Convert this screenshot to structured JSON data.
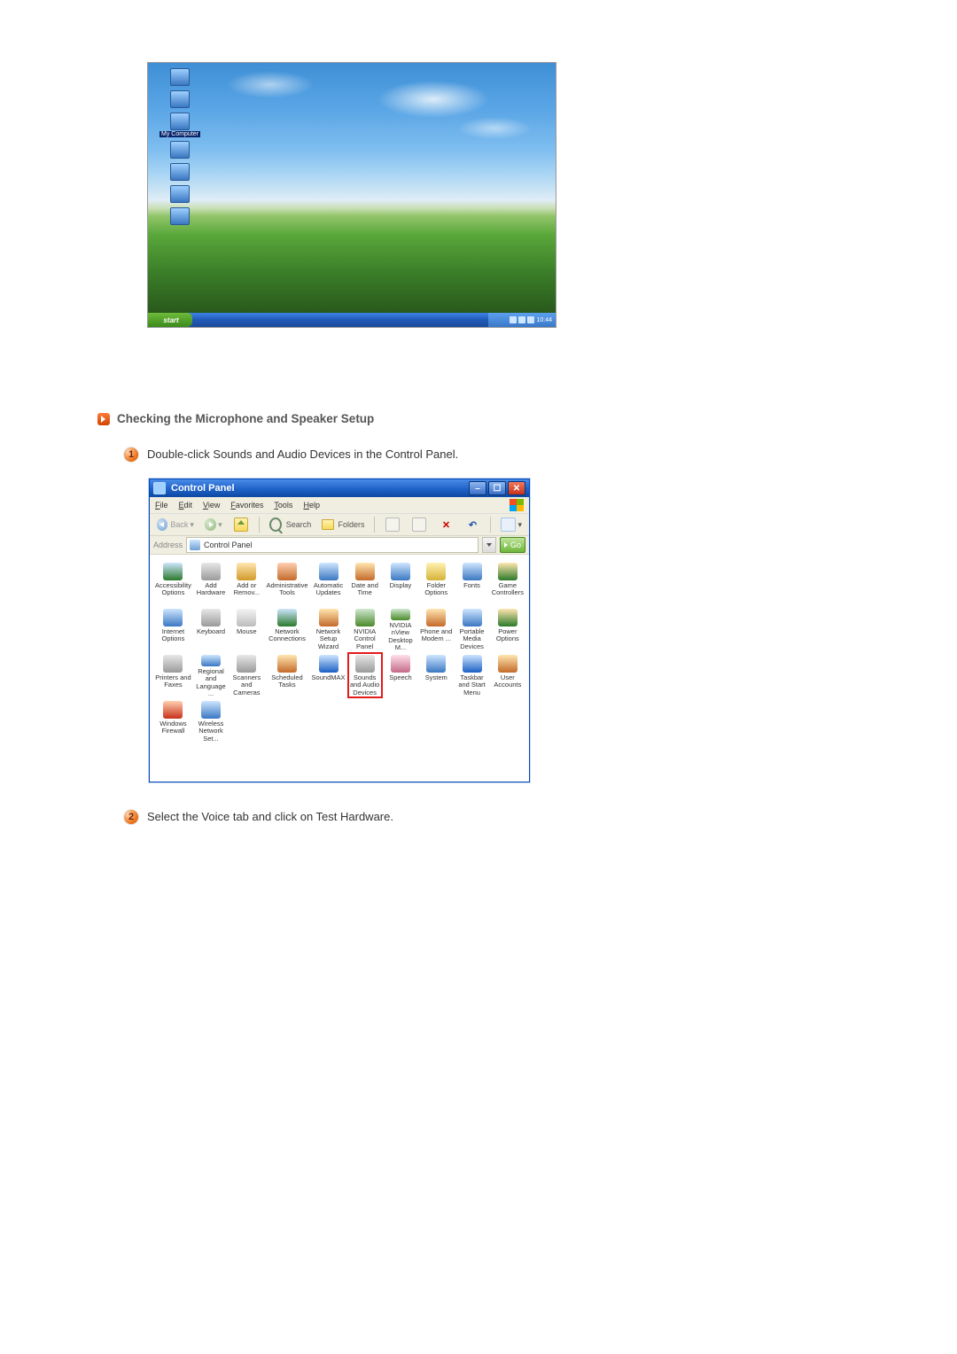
{
  "desktop": {
    "icons": [
      "",
      "",
      "My Computer",
      "",
      "",
      "",
      ""
    ],
    "selected_index": 2,
    "start_label": "start",
    "clock": "10:44"
  },
  "section_heading": "Checking the Microphone and Speaker Setup",
  "steps": [
    "Double-click Sounds and Audio Devices in the Control Panel.",
    "Select the Voice tab and click on Test Hardware."
  ],
  "control_panel": {
    "title": "Control Panel",
    "menu": [
      "File",
      "Edit",
      "View",
      "Favorites",
      "Tools",
      "Help"
    ],
    "toolbar": {
      "back": "Back",
      "search": "Search",
      "folders": "Folders"
    },
    "address_label": "Address",
    "address_value": "Control Panel",
    "go_label": "Go",
    "items": [
      {
        "label": "Accessibility Options",
        "color": "linear-gradient(#cfe6ff,#2a7a2a)"
      },
      {
        "label": "Add Hardware",
        "color": "linear-gradient(#e8e8e8,#9a9a9a)"
      },
      {
        "label": "Add or Remov...",
        "color": "linear-gradient(#ffe6b0,#d19a2a)"
      },
      {
        "label": "Administrative Tools",
        "color": "linear-gradient(#ffd0b0,#c46a2a)"
      },
      {
        "label": "Automatic Updates",
        "color": "linear-gradient(#cfe6ff,#3a78c2)"
      },
      {
        "label": "Date and Time",
        "color": "linear-gradient(#ffe6b0,#c46a2a)"
      },
      {
        "label": "Display",
        "color": "linear-gradient(#cfe6ff,#3a78c2)"
      },
      {
        "label": "Folder Options",
        "color": "linear-gradient(#fff2b0,#d6b23a)"
      },
      {
        "label": "Fonts",
        "color": "linear-gradient(#cfe6ff,#3a78c2)"
      },
      {
        "label": "Game Controllers",
        "color": "linear-gradient(#ffe6b0,#2a7a2a)"
      },
      {
        "label": "Internet Options",
        "color": "linear-gradient(#cfe6ff,#3a78c2)"
      },
      {
        "label": "Keyboard",
        "color": "linear-gradient(#e8e8e8,#9a9a9a)"
      },
      {
        "label": "Mouse",
        "color": "linear-gradient(#f4f4f4,#bcbcbc)"
      },
      {
        "label": "Network Connections",
        "color": "linear-gradient(#cfe6ff,#2a7a2a)"
      },
      {
        "label": "Network Setup Wizard",
        "color": "linear-gradient(#ffe6b0,#c46a2a)"
      },
      {
        "label": "NVIDIA Control Panel",
        "color": "linear-gradient(#d0e8d0,#4a8a2a)"
      },
      {
        "label": "NVIDIA nView Desktop M...",
        "color": "linear-gradient(#d0e8d0,#4a8a2a)"
      },
      {
        "label": "Phone and Modem ...",
        "color": "linear-gradient(#ffe6b0,#c46a2a)"
      },
      {
        "label": "Portable Media Devices",
        "color": "linear-gradient(#cfe6ff,#3a78c2)"
      },
      {
        "label": "Power Options",
        "color": "linear-gradient(#ffe6b0,#2a7a2a)"
      },
      {
        "label": "Printers and Faxes",
        "color": "linear-gradient(#e8e8e8,#9a9a9a)"
      },
      {
        "label": "Regional and Language ...",
        "color": "linear-gradient(#cfe6ff,#3a78c2)"
      },
      {
        "label": "Scanners and Cameras",
        "color": "linear-gradient(#e8e8e8,#9a9a9a)"
      },
      {
        "label": "Scheduled Tasks",
        "color": "linear-gradient(#ffe6b0,#c46a2a)"
      },
      {
        "label": "SoundMAX",
        "color": "linear-gradient(#cfe6ff,#1b5fc4)"
      },
      {
        "label": "Sounds and Audio Devices",
        "color": "linear-gradient(#e8e8e8,#9a9a9a)",
        "highlight": true
      },
      {
        "label": "Speech",
        "color": "linear-gradient(#ffe0e8,#c46a8a)"
      },
      {
        "label": "System",
        "color": "linear-gradient(#cfe6ff,#3a78c2)"
      },
      {
        "label": "Taskbar and Start Menu",
        "color": "linear-gradient(#cfe6ff,#1b5fc4)"
      },
      {
        "label": "User Accounts",
        "color": "linear-gradient(#ffe6b0,#c46a2a)"
      },
      {
        "label": "Windows Firewall",
        "color": "linear-gradient(#ffd0b0,#c8301a)"
      },
      {
        "label": "Wireless Network Set...",
        "color": "linear-gradient(#cfe6ff,#3a78c2)"
      }
    ]
  }
}
